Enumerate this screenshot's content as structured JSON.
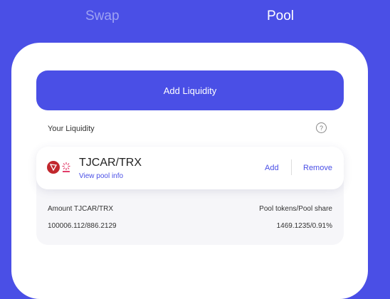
{
  "tabs": {
    "swap": "Swap",
    "pool": "Pool"
  },
  "add_liquidity_label": "Add Liquidity",
  "your_liquidity_label": "Your Liquidity",
  "help_icon_glyph": "?",
  "pool": {
    "pair": "TJCAR/TRX",
    "view_info": "View pool info",
    "add_label": "Add",
    "remove_label": "Remove",
    "amount_label": "Amount  TJCAR/TRX",
    "amount_value": "100006.112/886.2129",
    "share_label": "Pool tokens/Pool share",
    "share_value": "1469.1235/0.91%"
  },
  "colors": {
    "accent": "#4a4fe6",
    "tron_red": "#c1272d",
    "tjcar_pink": "#e23d6a"
  },
  "icons": {
    "token_a": "tron-icon",
    "token_b": "tjcar-icon"
  }
}
